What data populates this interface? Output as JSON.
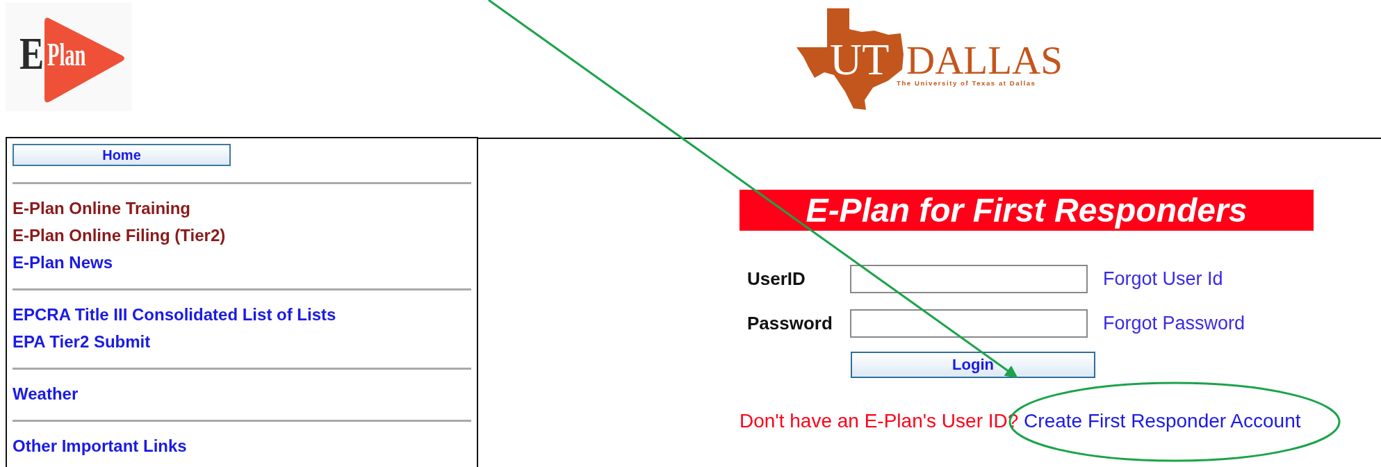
{
  "header": {
    "eplan_logo": {
      "letter": "E",
      "word": "Plan"
    },
    "utd_logo": {
      "initials": "UT",
      "name": "DALLAS",
      "subtitle": "The University of Texas at Dallas"
    }
  },
  "sidebar": {
    "home_button": "Home",
    "groups": [
      {
        "links": [
          {
            "label": "E-Plan Online Training",
            "visited": true
          },
          {
            "label": "E-Plan Online Filing (Tier2)",
            "visited": true
          },
          {
            "label": "E-Plan News",
            "visited": false
          }
        ]
      },
      {
        "links": [
          {
            "label": "EPCRA Title III Consolidated List of Lists",
            "visited": false
          },
          {
            "label": "EPA Tier2 Submit",
            "visited": false
          }
        ]
      },
      {
        "links": [
          {
            "label": "Weather",
            "visited": false
          }
        ]
      },
      {
        "links": [
          {
            "label": "Other Important Links",
            "visited": false
          }
        ]
      }
    ]
  },
  "login": {
    "title": "E-Plan for First Responders",
    "fields": [
      {
        "label": "UserID",
        "link": "Forgot User Id"
      },
      {
        "label": "Password",
        "link": "Forgot Password"
      }
    ],
    "button": "Login",
    "prompt": "Don't have an E-Plan's User ID?",
    "signup_link": "Create First Responder Account"
  }
}
